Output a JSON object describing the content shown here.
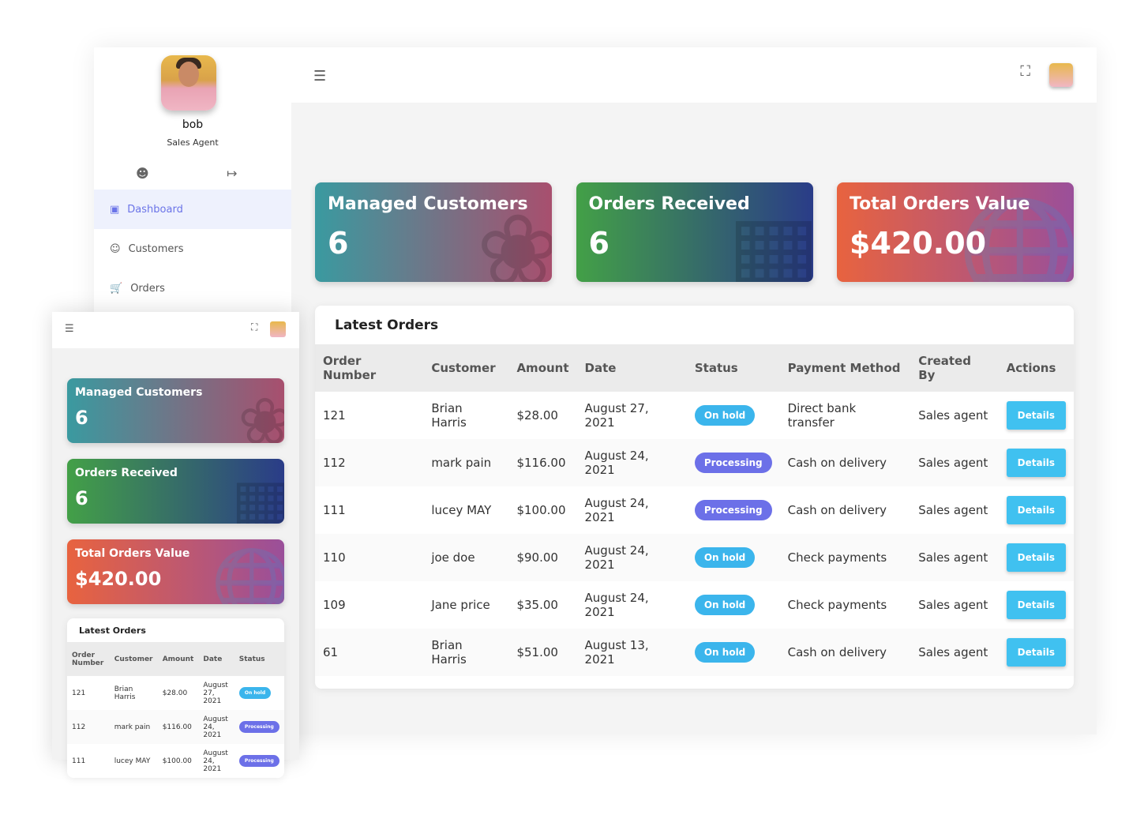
{
  "user": {
    "name": "bob",
    "role": "Sales Agent"
  },
  "sidebar": {
    "items": [
      {
        "label": "Dashboard",
        "icon": "monitor-icon",
        "active": true
      },
      {
        "label": "Customers",
        "icon": "users-icon"
      },
      {
        "label": "Orders",
        "icon": "cart-icon"
      }
    ]
  },
  "cards": [
    {
      "title": "Managed Customers",
      "value": "6",
      "icon": "award-icon"
    },
    {
      "title": "Orders Received",
      "value": "6",
      "icon": "briefcase-icon"
    },
    {
      "title": "Total Orders Value",
      "value": "$420.00",
      "icon": "globe-icon"
    }
  ],
  "table": {
    "title": "Latest Orders",
    "columns": [
      "Order Number",
      "Customer",
      "Amount",
      "Date",
      "Status",
      "Payment Method",
      "Created By",
      "Actions"
    ],
    "rows": [
      [
        "121",
        "Brian Harris",
        "$28.00",
        "August 27, 2021",
        "On hold",
        "Direct bank transfer",
        "Sales agent",
        "Details"
      ],
      [
        "112",
        "mark pain",
        "$116.00",
        "August 24, 2021",
        "Processing",
        "Cash on delivery",
        "Sales agent",
        "Details"
      ],
      [
        "111",
        "lucey MAY",
        "$100.00",
        "August 24, 2021",
        "Processing",
        "Cash on delivery",
        "Sales agent",
        "Details"
      ],
      [
        "110",
        "joe doe",
        "$90.00",
        "August 24, 2021",
        "On hold",
        "Check payments",
        "Sales agent",
        "Details"
      ],
      [
        "109",
        "Jane price",
        "$35.00",
        "August 24, 2021",
        "On hold",
        "Check payments",
        "Sales agent",
        "Details"
      ],
      [
        "61",
        "Brian Harris",
        "$51.00",
        "August 13, 2021",
        "On hold",
        "Cash on delivery",
        "Sales agent",
        "Details"
      ]
    ]
  },
  "colors": {
    "on_hold": "#3bb5ec",
    "processing": "#6c70e8",
    "details": "#40c1f0",
    "active_nav": "#6b74e8"
  }
}
